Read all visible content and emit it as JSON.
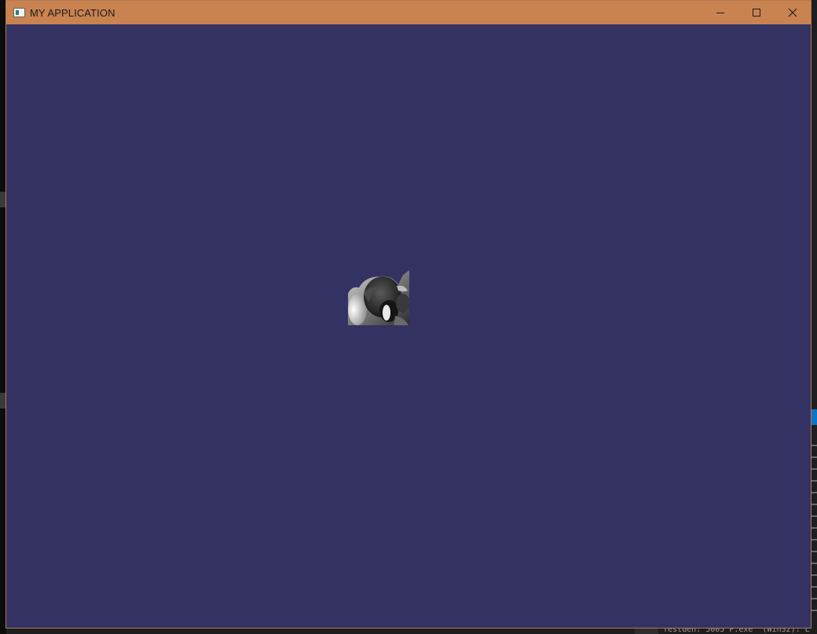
{
  "window": {
    "title": "MY APPLICATION",
    "icon": "app-window-icon",
    "controls": {
      "minimize": "minimize-icon",
      "maximize": "maximize-icon",
      "close": "close-icon"
    },
    "colors": {
      "titlebar": "#c98350",
      "client_background": "#343263"
    }
  },
  "content": {
    "sprite": "rendered-grayscale-sprite"
  },
  "background": {
    "console_text": "'TestGen: 5005 P.exe' (Win32): L"
  }
}
